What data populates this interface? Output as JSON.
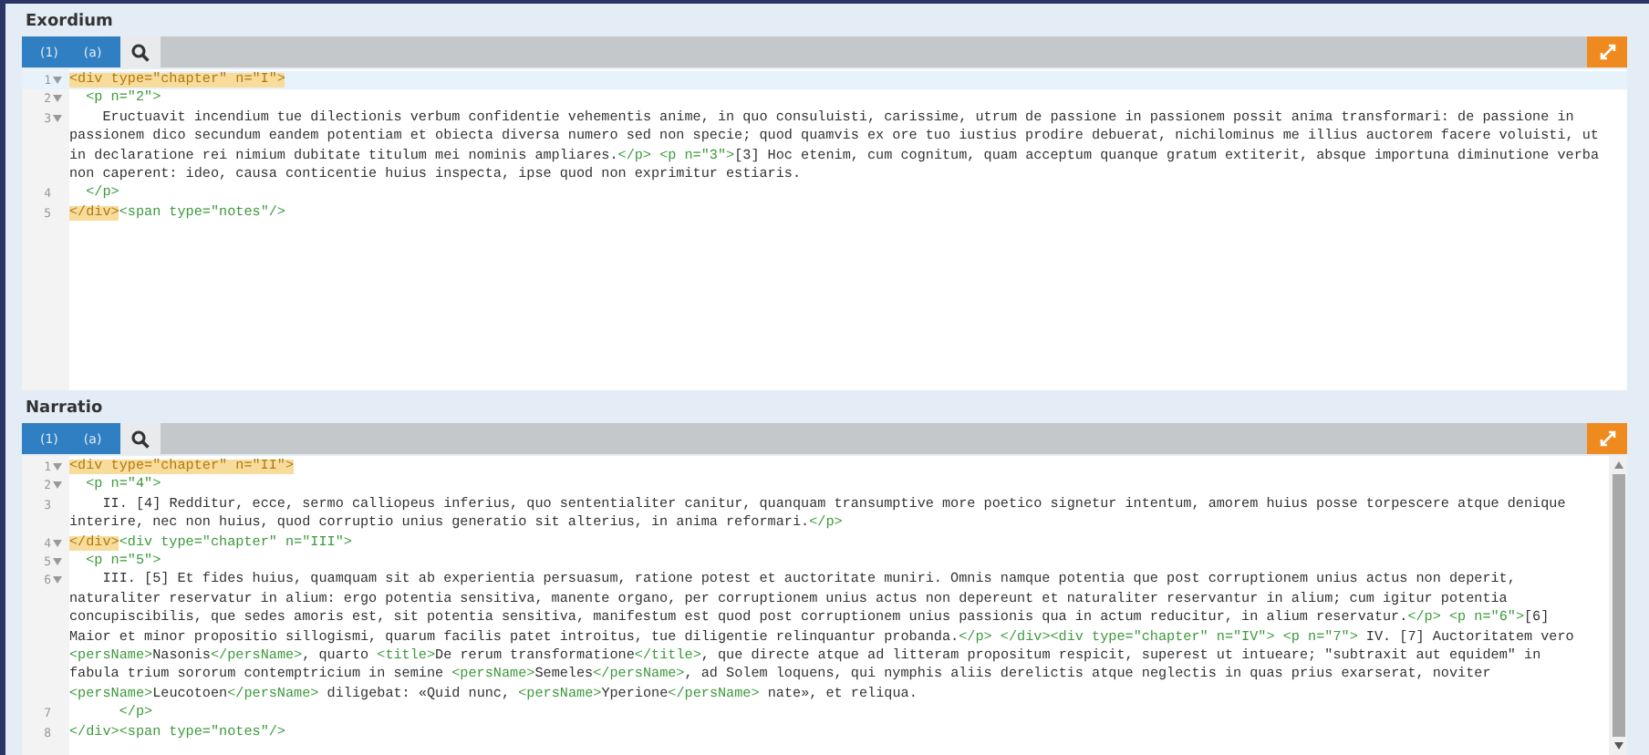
{
  "panels": [
    {
      "title": "Exordium",
      "buttons": [
        {
          "label": "(1)"
        },
        {
          "label": "(a)"
        }
      ],
      "scrollbar": false,
      "lines": [
        {
          "number": "1",
          "fold": true,
          "active": true,
          "match": true,
          "text": "<div type=\"chapter\" n=\"I\">"
        },
        {
          "number": "2",
          "fold": true,
          "active": false,
          "match": false,
          "text": "  <p n=\"2\">"
        },
        {
          "number": "3",
          "fold": true,
          "active": false,
          "match": false,
          "text": "    Eructuavit incendium tue dilectionis verbum confidentie vehementis anime, in quo consuluisti, carissime, utrum de passione in passionem possit anima transformari: de passione in passionem dico secundum eandem potentiam et obiecta diversa numero sed non specie; quod quamvis ex ore tuo iustius prodire debuerat, nichilominus me illius auctorem facere voluisti, ut in declaratione rei nimium dubitate titulum mei nominis ampliares.</p> <p n=\"3\">[3] Hoc etenim, cum cognitum, quam acceptum quanque gratum extiterit, absque importuna diminutione verba non caperent: ideo, causa conticentie huius inspecta, ipse quod non exprimitur estiaris."
        },
        {
          "number": "4",
          "fold": false,
          "active": false,
          "match": false,
          "text": "  </p>"
        },
        {
          "number": "5",
          "fold": false,
          "active": false,
          "match": true,
          "text": "</div><span type=\"notes\"/>"
        }
      ]
    },
    {
      "title": "Narratio",
      "buttons": [
        {
          "label": "(1)"
        },
        {
          "label": "(a)"
        }
      ],
      "scrollbar": true,
      "lines": [
        {
          "number": "1",
          "fold": true,
          "active": false,
          "match": true,
          "text": "<div type=\"chapter\" n=\"II\">"
        },
        {
          "number": "2",
          "fold": true,
          "active": false,
          "match": false,
          "text": "  <p n=\"4\">"
        },
        {
          "number": "3",
          "fold": false,
          "active": false,
          "match": false,
          "text": "    II. [4] Redditur, ecce, sermo calliopeus inferius, quo sententialiter canitur, quanquam transumptive more poetico signetur intentum, amorem huius posse torpescere atque denique interire, nec non huius, quod corruptio unius generatio sit alterius, in anima reformari.</p>"
        },
        {
          "number": "4",
          "fold": true,
          "active": false,
          "match": true,
          "text": "</div><div type=\"chapter\" n=\"III\">"
        },
        {
          "number": "5",
          "fold": true,
          "active": false,
          "match": false,
          "text": "  <p n=\"5\">"
        },
        {
          "number": "6",
          "fold": true,
          "active": false,
          "match": false,
          "text": "    III. [5] Et fides huius, quamquam sit ab experientia persuasum, ratione potest et auctoritate muniri. Omnis namque potentia que post corruptionem unius actus non deperit, naturaliter reservatur in alium: ergo potentia sensitiva, manente organo, per corruptionem unius actus non depereunt et naturaliter reservantur in alium; cum igitur potentia concupiscibilis, que sedes amoris est, sit potentia sensitiva, manifestum est quod post corruptionem unius passionis qua in actum reducitur, in alium reservatur.</p> <p n=\"6\">[6] Maior et minor propositio sillogismi, quarum facilis patet introitus, tue diligentie relinquantur probanda.</p> </div><div type=\"chapter\" n=\"IV\"> <p n=\"7\"> IV. [7] Auctoritatem vero <persName>Nasonis</persName>, quarto <title>De rerum transformatione</title>, que directe atque ad litteram propositum respicit, superest ut intueare; \"subtraxit aut equidem\" in fabula trium sororum contemptricium in semine <persName>Semeles</persName>, ad Solem loquens, qui nymphis aliis derelictis atque neglectis in quas prius exarserat, noviter <persName>Leucotoen</persName> diligebat: «Quid nunc, <persName>Yperione</persName> nate», et reliqua."
        },
        {
          "number": "7",
          "fold": false,
          "active": false,
          "match": false,
          "text": "      </p>"
        },
        {
          "number": "8",
          "fold": false,
          "active": false,
          "match": false,
          "text": "</div><span type=\"notes\"/>"
        }
      ]
    }
  ]
}
